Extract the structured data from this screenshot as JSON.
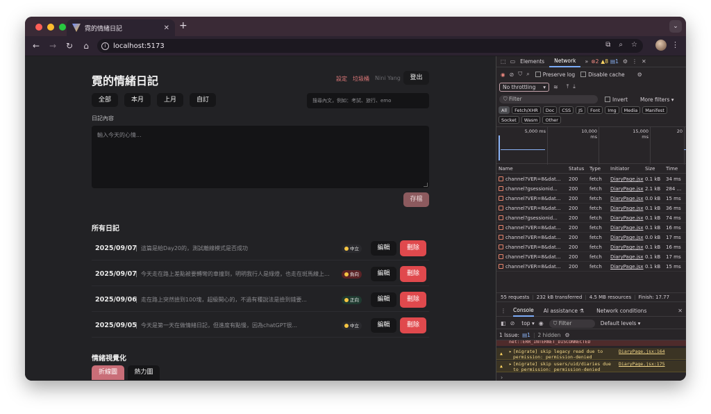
{
  "browser": {
    "tab_title": "霓的情緒日記",
    "url": "localhost:5173"
  },
  "app": {
    "title": "霓的情緒日記",
    "links": {
      "settings": "設定",
      "trash": "垃圾桶",
      "user": "Nini Yang"
    },
    "logout": "登出",
    "filters": [
      "全部",
      "本月",
      "上月",
      "自訂"
    ],
    "search_placeholder": "搜尋內文，例如：考試、旅行、emo",
    "content_label": "日記內容",
    "textarea_placeholder": "輸入今天的心情...",
    "save": "存檔",
    "all_entries": "所有日記",
    "edit_label": "編輯",
    "delete_label": "刪除",
    "entries": [
      {
        "date": "2025/09/07",
        "text": "這篇是給Day20的，測試離線模式是否成功",
        "mood": "中立",
        "mood_color": "#2a2a2e"
      },
      {
        "date": "2025/09/07",
        "text": "今天走在路上差點被要轉彎的車撞到，明明我行人是綠燈，也走在斑馬線上...",
        "mood": "負向",
        "mood_color": "#5a2326"
      },
      {
        "date": "2025/09/06",
        "text": "走在路上突然撿到100塊，超級開心的，不過有種說法是撿到錢要...",
        "mood": "正向",
        "mood_color": "#1f3a30"
      },
      {
        "date": "2025/09/05",
        "text": "今天是第一天在做情緒日記，但進度有點慢，因為chatGPT很...",
        "mood": "中立",
        "mood_color": "#2a2a2e"
      }
    ],
    "viz_title": "情緒視覺化",
    "viz_tabs": [
      "折線圖",
      "熱力圖"
    ]
  },
  "devtools": {
    "tabs": [
      "Elements",
      "Network"
    ],
    "counts": {
      "errors": "2",
      "warnings": "8",
      "issues": "1"
    },
    "preserve_log": "Preserve log",
    "disable_cache": "Disable cache",
    "throttling": "No throttling",
    "filter_placeholder": "Filter",
    "invert": "Invert",
    "more_filters": "More filters",
    "type_filters": [
      "All",
      "Fetch/XHR",
      "Doc",
      "CSS",
      "JS",
      "Font",
      "Img",
      "Media",
      "Manifest",
      "Socket",
      "Wasm",
      "Other"
    ],
    "timeline_ticks": [
      "5,000 ms",
      "10,000 ms",
      "15,000 ms",
      "20"
    ],
    "columns": [
      "Name",
      "Status",
      "Type",
      "Initiator",
      "Size",
      "Time"
    ],
    "rows": [
      [
        "channel?VER=8&dat...",
        "200",
        "fetch",
        "DiaryPage.jsx",
        "0.1 kB",
        "34 ms"
      ],
      [
        "channel?gsessionid...",
        "200",
        "fetch",
        "DiaryPage.jsx",
        "2.1 kB",
        "284 ..."
      ],
      [
        "channel?VER=8&dat...",
        "200",
        "fetch",
        "DiaryPage.jsx",
        "0.0 kB",
        "15 ms"
      ],
      [
        "channel?VER=8&dat...",
        "200",
        "fetch",
        "DiaryPage.jsx",
        "0.1 kB",
        "36 ms"
      ],
      [
        "channel?gsessionid...",
        "200",
        "fetch",
        "DiaryPage.jsx",
        "0.1 kB",
        "74 ms"
      ],
      [
        "channel?VER=8&dat...",
        "200",
        "fetch",
        "DiaryPage.jsx",
        "0.1 kB",
        "16 ms"
      ],
      [
        "channel?VER=8&dat...",
        "200",
        "fetch",
        "DiaryPage.jsx",
        "0.0 kB",
        "17 ms"
      ],
      [
        "channel?VER=8&dat...",
        "200",
        "fetch",
        "DiaryPage.jsx",
        "0.1 kB",
        "16 ms"
      ],
      [
        "channel?VER=8&dat...",
        "200",
        "fetch",
        "DiaryPage.jsx",
        "0.1 kB",
        "17 ms"
      ],
      [
        "channel?VER=8&dat...",
        "200",
        "fetch",
        "DiaryPage.jsx",
        "0.1 kB",
        "15 ms"
      ]
    ],
    "summary": {
      "requests": "55 requests",
      "transferred": "232 kB transferred",
      "resources": "4.5 MB resources",
      "finish": "Finish: 17.77"
    },
    "drawer_tabs": [
      "Console",
      "AI assistance",
      "Network conditions"
    ],
    "console_context": "top",
    "console_filter": "Filter",
    "default_levels": "Default levels",
    "issue_text": "1 Issue:",
    "issue_count": "1",
    "hidden": "2 hidden",
    "err_trunc": "net::ERR_INTERNET_DISCONNECTED",
    "warnings": [
      {
        "msg": "[migrate] skip legacy read due to permission: permission-denied",
        "src": "DiaryPage.jsx:164"
      },
      {
        "msg": "[migrate] skip users/uid/diaries due to permission: permission-denied",
        "src": "DiaryPage.jsx:175"
      }
    ]
  }
}
